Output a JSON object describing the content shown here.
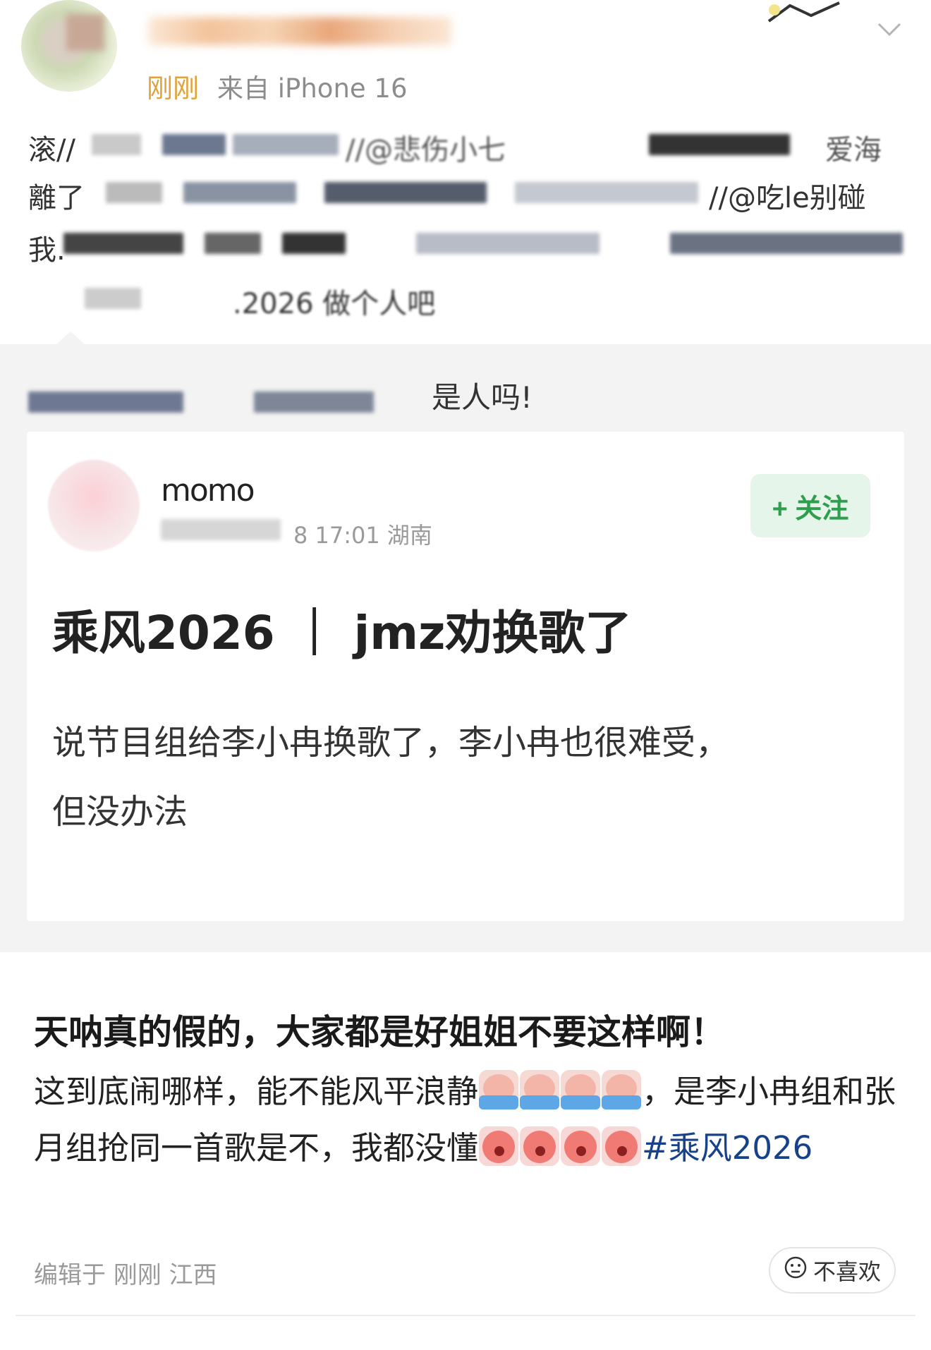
{
  "header": {
    "time": "刚刚",
    "source": "来自 iPhone 16"
  },
  "repost_chain": {
    "line1_start": "滚//",
    "line1_mid": "//@悲伤小七",
    "line1_end": "爱海",
    "line2_start": "離了",
    "line2_end": "//@吃le别碰",
    "line3_start": "我.",
    "line4_partial": ".2026 做个人吧"
  },
  "repost": {
    "text": "是人吗!"
  },
  "card": {
    "name": "momo",
    "meta": "8 17:01 湖南",
    "follow_label": "+ 关注",
    "title": "乘风2026 ｜ jmz劝换歌了",
    "body_line1": "说节目组给李小冉换歌了，李小冉也很难受，",
    "body_line2": "但没办法"
  },
  "post": {
    "title": "天呐真的假的，大家都是好姐姐不要这样啊！",
    "body_part1": "这到底闹哪样，能不能风平浪静",
    "body_part2": "，是李小冉组和张月组抢同一首歌是不，我都没懂",
    "hashtag": "#乘风2026",
    "edit_info": "编辑于 刚刚 江西",
    "dislike_label": "不喜欢"
  },
  "colors": {
    "time_accent": "#e1a23a",
    "follow_green": "#2f9e4f",
    "hashtag_blue": "#17418a",
    "repost_bg": "#f3f3f3"
  },
  "icons": [
    "avatar",
    "chevron-down-icon",
    "emoji-crying-icon",
    "emoji-sad-icon",
    "dislike-face-icon"
  ]
}
